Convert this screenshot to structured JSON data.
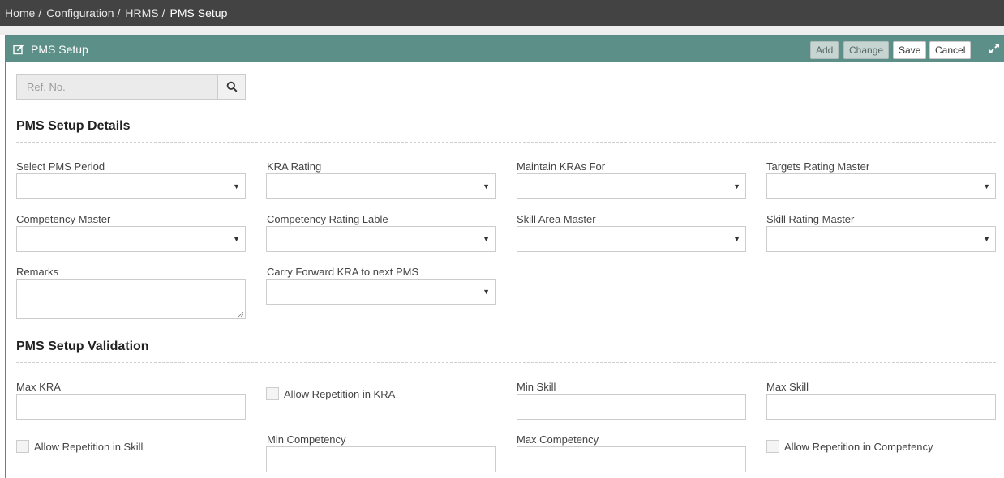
{
  "breadcrumb": {
    "items": [
      "Home",
      "Configuration",
      "HRMS",
      "PMS Setup"
    ],
    "separator": "/"
  },
  "panel": {
    "title": "PMS Setup",
    "title_icon": "edit-icon",
    "buttons": {
      "add": "Add",
      "change": "Change",
      "save": "Save",
      "cancel": "Cancel"
    },
    "expand_icon": "expand-icon"
  },
  "ref": {
    "placeholder": "Ref. No.",
    "search_icon": "search-icon"
  },
  "details": {
    "title": "PMS Setup Details",
    "fields": {
      "pms_period": "Select PMS Period",
      "kra_rating": "KRA Rating",
      "maintain_kras_for": "Maintain KRAs For",
      "targets_rating_master": "Targets Rating Master",
      "competency_master": "Competency Master",
      "competency_rating_lable": "Competency Rating Lable",
      "skill_area_master": "Skill Area Master",
      "skill_rating_master": "Skill Rating Master",
      "remarks": "Remarks",
      "carry_forward": "Carry Forward KRA to next PMS"
    }
  },
  "validation": {
    "title": "PMS Setup Validation",
    "fields": {
      "max_kra": "Max KRA",
      "allow_rep_kra": "Allow Repetition in KRA",
      "min_skill": "Min Skill",
      "max_skill": "Max Skill",
      "allow_rep_skill": "Allow Repetition in Skill",
      "min_competency": "Min Competency",
      "max_competency": "Max Competency",
      "allow_rep_competency": "Allow Repetition in Competency"
    }
  },
  "colors": {
    "topbar": "#434343",
    "header": "#5b8f88"
  }
}
